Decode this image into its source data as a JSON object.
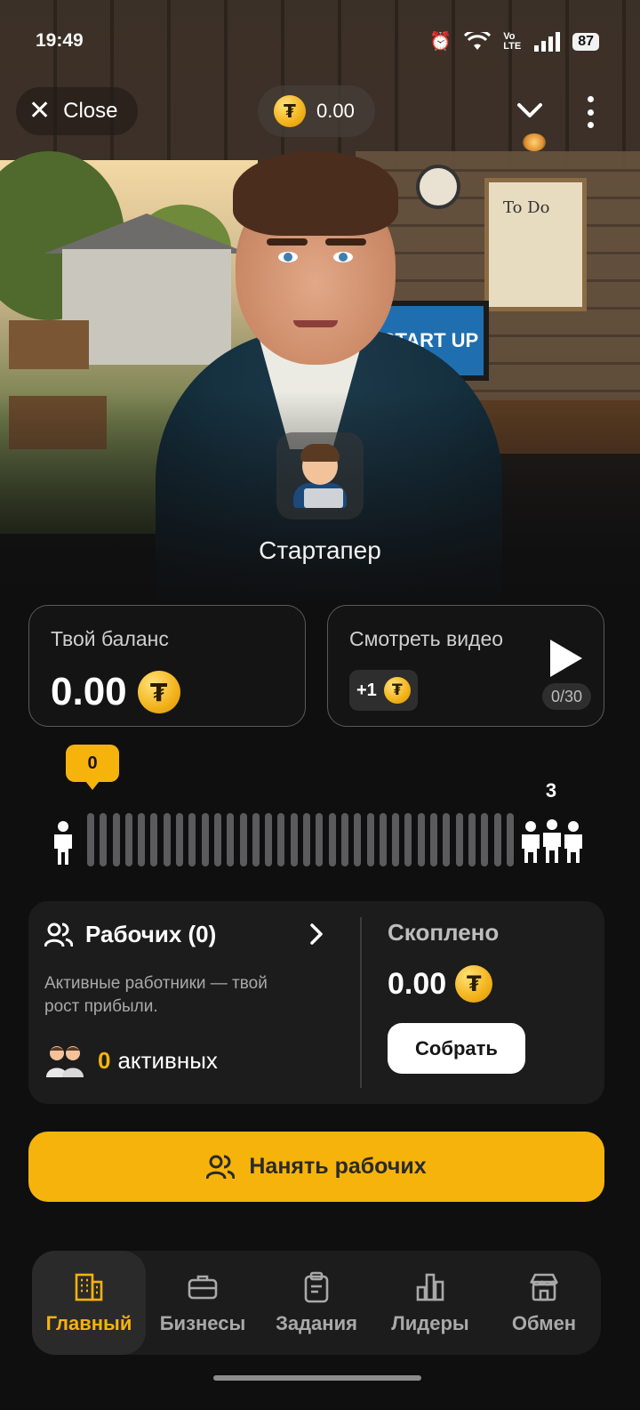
{
  "status_bar": {
    "time": "19:49",
    "battery": "87",
    "network_label": "Vo\nLTE"
  },
  "top_bar": {
    "close_label": "Close",
    "balance": "0.00"
  },
  "scene": {
    "monitor_text": "START UP",
    "board_text": "To Do"
  },
  "level": {
    "title": "Стартапер"
  },
  "balance_card": {
    "label": "Твой баланс",
    "value": "0.00"
  },
  "video_card": {
    "label": "Смотреть видео",
    "reward": "+1",
    "counter": "0/30"
  },
  "progress": {
    "current": "0",
    "max": "3",
    "fraction": 0
  },
  "workers": {
    "title": "Рабочих (0)",
    "description": "Активные работники — твой рост прибыли.",
    "active_count": "0",
    "active_label": "активных"
  },
  "saved": {
    "label": "Скоплено",
    "value": "0.00",
    "collect_label": "Собрать"
  },
  "hire_button": {
    "label": "Нанять рабочих"
  },
  "nav": [
    {
      "label": "Главный",
      "icon": "building-icon",
      "active": true
    },
    {
      "label": "Бизнесы",
      "icon": "briefcase-icon",
      "active": false
    },
    {
      "label": "Задания",
      "icon": "clipboard-icon",
      "active": false
    },
    {
      "label": "Лидеры",
      "icon": "bar-chart-icon",
      "active": false
    },
    {
      "label": "Обмен",
      "icon": "store-icon",
      "active": false
    }
  ],
  "colors": {
    "accent": "#f6b30c",
    "background": "#0f0f10",
    "panel": "#1c1c1d"
  }
}
